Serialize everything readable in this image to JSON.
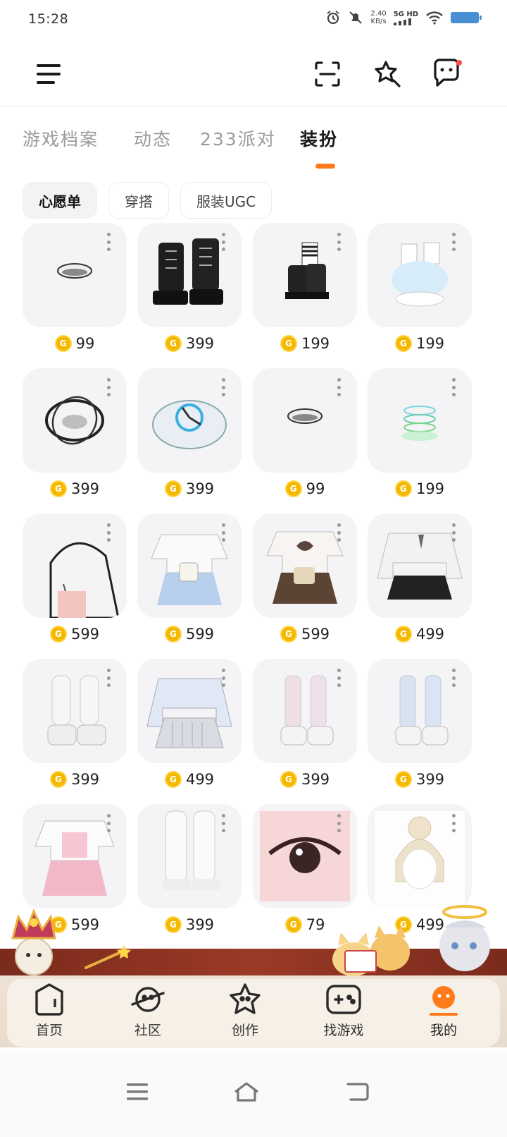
{
  "status_bar": {
    "time": "15:28",
    "speed_value": "2.40",
    "speed_unit": "KB/s",
    "network": "5G HD"
  },
  "tabs": [
    {
      "label": "游戏档案"
    },
    {
      "label": "动态"
    },
    {
      "label": "233派对"
    },
    {
      "label": "装扮"
    }
  ],
  "active_tab": "装扮",
  "chips": [
    {
      "label": "心愿单"
    },
    {
      "label": "穿搭"
    },
    {
      "label": "服装UGC"
    }
  ],
  "items": [
    {
      "price": "99",
      "icon": "eye-lens-item"
    },
    {
      "price": "399",
      "icon": "black-boots-item"
    },
    {
      "price": "199",
      "icon": "striped-socks-shoes-item"
    },
    {
      "price": "199",
      "icon": "fluffy-leg-warmers-item"
    },
    {
      "price": "399",
      "icon": "dark-ring-item"
    },
    {
      "price": "399",
      "icon": "clock-effect-item"
    },
    {
      "price": "99",
      "icon": "eye-lens-item"
    },
    {
      "price": "199",
      "icon": "ripple-effect-item"
    },
    {
      "price": "599",
      "icon": "white-hair-item"
    },
    {
      "price": "599",
      "icon": "white-top-blue-skirt-item"
    },
    {
      "price": "599",
      "icon": "heart-shirt-brown-skirt-item"
    },
    {
      "price": "499",
      "icon": "white-shirt-black-skirt-item"
    },
    {
      "price": "399",
      "icon": "white-leg-warmers-item"
    },
    {
      "price": "499",
      "icon": "blue-shirt-grey-skirt-item"
    },
    {
      "price": "399",
      "icon": "pink-leg-warmers-item"
    },
    {
      "price": "399",
      "icon": "blue-leg-warmers-item"
    },
    {
      "price": "599",
      "icon": "pink-skirt-outfit-item"
    },
    {
      "price": "399",
      "icon": "white-boots-item"
    },
    {
      "price": "79",
      "icon": "eye-makeup-item"
    },
    {
      "price": "499",
      "icon": "bun-hairstyle-item"
    }
  ],
  "bottom_nav": [
    {
      "label": "首页",
      "icon": "home-icon"
    },
    {
      "label": "社区",
      "icon": "planet-icon"
    },
    {
      "label": "创作",
      "icon": "star-create-icon"
    },
    {
      "label": "找游戏",
      "icon": "gamepad-icon"
    },
    {
      "label": "我的",
      "icon": "profile-face-icon"
    }
  ],
  "colors": {
    "accent": "#ff7a1a",
    "coin": "#f5b800"
  }
}
